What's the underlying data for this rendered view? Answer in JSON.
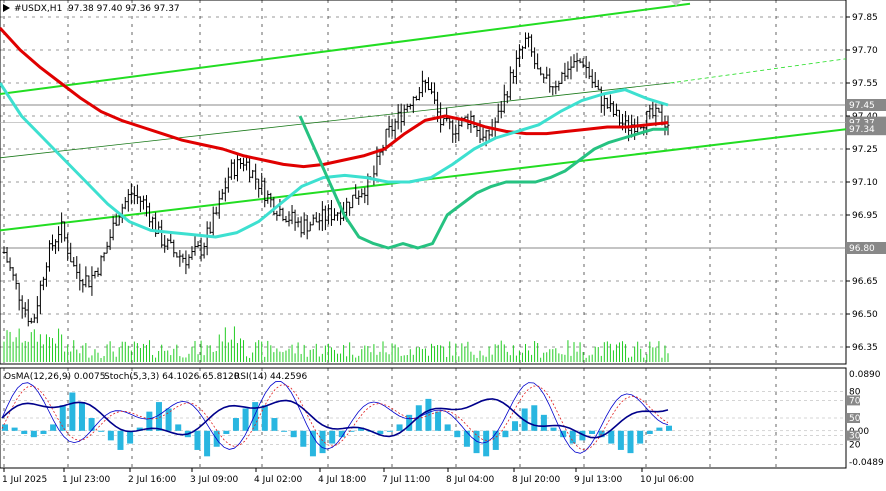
{
  "header": {
    "symbol": "#USDX,H1",
    "ohlc": "97.38 97.40 97.36 97.37"
  },
  "indicator_header": {
    "osma": "OsMA(12,26,9) 0.0075",
    "stoch": "Stoch(5,3,3) 64.1026 65.8120",
    "rsi": "RSI(14) 44.2596"
  },
  "colors": {
    "candles": "#000000",
    "ma_red": "#e00000",
    "ma_cyan": "#3de0d0",
    "ma_green": "#26c281",
    "channel_line": "#22dd22",
    "osma_bars": "#29b6e0",
    "rsi_line": "#00008b",
    "stoch_main": "#e02020",
    "stoch_signal": "#0000cc",
    "grid": "#000000",
    "level_line": "#888888"
  },
  "chart_data": [
    {
      "type": "line",
      "title": "#USDX,H1",
      "y_ticks": [
        "97.85",
        "97.70",
        "97.55",
        "97.40",
        "97.25",
        "97.10",
        "96.95",
        "96.80",
        "96.65",
        "96.50",
        "96.35"
      ],
      "ylim": [
        96.3,
        97.9
      ],
      "x_labels": [
        "1 Jul 2025",
        "1 Jul 23:00",
        "2 Jul 16:00",
        "3 Jul 09:00",
        "4 Jul 02:00",
        "4 Jul 18:00",
        "7 Jul 11:00",
        "8 Jul 04:00",
        "8 Jul 20:00",
        "9 Jul 13:00",
        "10 Jul 06:00"
      ],
      "price_labels": [
        {
          "value": 97.45,
          "text": "97.45"
        },
        {
          "value": 97.37,
          "text": "97.37"
        },
        {
          "value": 97.34,
          "text": "97.34"
        },
        {
          "value": 96.8,
          "text": "96.80"
        }
      ],
      "horizontal_levels": [
        97.45,
        96.8
      ],
      "series": [
        {
          "values": [
            96.78,
            96.6,
            96.45,
            96.75,
            96.9,
            96.7,
            96.65,
            96.75,
            96.95,
            97.05,
            97.0,
            96.85,
            96.78,
            96.75,
            96.8,
            96.95,
            97.15,
            97.2,
            97.1,
            97.0,
            96.95,
            96.9,
            96.92,
            96.95,
            96.98,
            97.05,
            97.1,
            97.3,
            97.4,
            97.5,
            97.55,
            97.35,
            97.35,
            97.4,
            97.28,
            97.4,
            97.6,
            97.75,
            97.55,
            97.55,
            97.62,
            97.65,
            97.5,
            97.42,
            97.35,
            97.38,
            97.4,
            97.37
          ]
        },
        {
          "values": [
            97.8,
            97.7,
            97.62,
            97.55,
            97.48,
            97.42,
            97.38,
            97.35,
            97.32,
            97.29,
            97.27,
            97.25,
            97.22,
            97.2,
            97.18,
            97.17,
            97.18,
            97.2,
            97.22,
            97.25,
            97.32,
            97.38,
            97.4,
            97.38,
            97.35,
            97.33,
            97.32,
            97.32,
            97.33,
            97.34,
            97.35,
            97.35,
            97.36,
            97.37
          ]
        },
        {
          "values": [
            97.55,
            97.4,
            97.3,
            97.2,
            97.1,
            97.0,
            96.92,
            96.88,
            96.87,
            96.86,
            96.85,
            96.87,
            96.92,
            97.0,
            97.08,
            97.12,
            97.13,
            97.12,
            97.1,
            97.1,
            97.12,
            97.18,
            97.25,
            97.3,
            97.33,
            97.36,
            97.42,
            97.47,
            97.5,
            97.52,
            97.48,
            97.45
          ]
        },
        {
          "values": [
            97.4,
            97.25,
            97.1,
            96.95,
            96.85,
            96.82,
            96.8,
            96.82,
            96.8,
            96.82,
            96.95,
            97.0,
            97.05,
            97.08,
            97.1,
            97.1,
            97.1,
            97.12,
            97.15,
            97.2,
            97.25,
            97.28,
            97.3,
            97.32,
            97.34,
            97.34
          ]
        }
      ]
    },
    {
      "type": "bar",
      "title": "OsMA(12,26,9) / Stoch(5,3,3) / RSI(14)",
      "y_ticks": [
        "0.0890",
        "80",
        "70",
        "50",
        "0.00",
        "30",
        "20",
        "-0.0489"
      ],
      "ylim": [
        -0.0489,
        0.089
      ],
      "values": [
        0.01,
        0.005,
        -0.005,
        -0.01,
        -0.005,
        0.01,
        0.04,
        0.06,
        0.045,
        0.02,
        0.0,
        -0.015,
        -0.03,
        -0.02,
        0.005,
        0.03,
        0.045,
        0.035,
        0.01,
        -0.01,
        -0.03,
        -0.04,
        -0.025,
        -0.005,
        0.02,
        0.035,
        0.045,
        0.04,
        0.02,
        0.0,
        -0.01,
        -0.025,
        -0.04,
        -0.035,
        -0.02,
        -0.01,
        0.0,
        0.005,
        0.0,
        -0.005,
        0.0,
        0.01,
        0.025,
        0.04,
        0.05,
        0.03,
        0.01,
        -0.01,
        -0.025,
        -0.035,
        -0.04,
        -0.03,
        -0.01,
        0.015,
        0.035,
        0.04,
        0.025,
        0.005,
        -0.01,
        -0.02,
        -0.015,
        -0.005,
        -0.01,
        -0.02,
        -0.03,
        -0.035,
        -0.02,
        -0.005,
        0.005,
        0.008
      ]
    }
  ]
}
